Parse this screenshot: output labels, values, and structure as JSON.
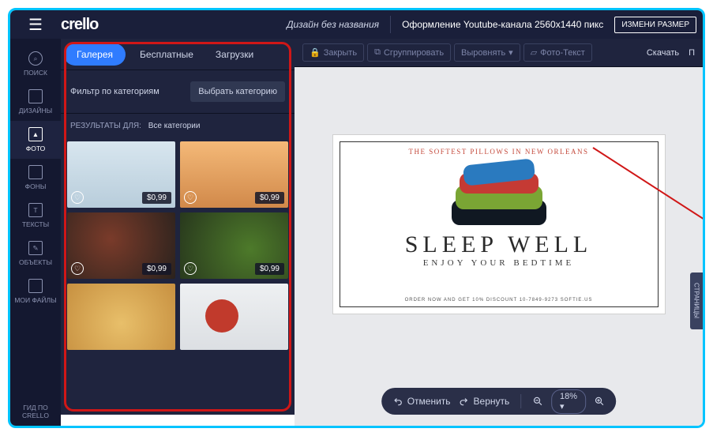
{
  "header": {
    "logo": "crello",
    "project_title": "Дизайн без названия",
    "format": "Оформление Youtube-канала 2560x1440 пикс",
    "resize_btn": "ИЗМЕНИ РАЗМЕР"
  },
  "toolbar": {
    "close": "Закрыть",
    "group": "Сгруппировать",
    "align": "Выровнять",
    "phototext": "Фото-Текст",
    "download": "Скачать"
  },
  "leftnav": {
    "items": [
      {
        "label": "ПОИСК"
      },
      {
        "label": "ДИЗАЙНЫ"
      },
      {
        "label": "ФОТО"
      },
      {
        "label": "ФОНЫ"
      },
      {
        "label": "ТЕКСТЫ"
      },
      {
        "label": "ОБЪЕКТЫ"
      },
      {
        "label": "МОИ ФАЙЛЫ"
      }
    ],
    "guide": "ГИД ПО CRELLO"
  },
  "panel": {
    "tabs": [
      "Галерея",
      "Бесплатные",
      "Загрузки"
    ],
    "filter_label": "Фильтр по категориям",
    "filter_btn": "Выбрать категорию",
    "results_label": "РЕЗУЛЬТАТЫ ДЛЯ:",
    "results_value": "Все категории",
    "price": "$0,99"
  },
  "artboard": {
    "tagline": "THE SOFTEST PILLOWS IN NEW ORLEANS",
    "h1": "SLEEP WELL",
    "h2": "ENJOY YOUR BEDTIME",
    "footer": "ORDER NOW AND GET 10% DISCOUNT   10-7849-9273   SOFTIE.US"
  },
  "zoombar": {
    "undo": "Отменить",
    "redo": "Вернуть",
    "zoom": "18%"
  },
  "side_tab": "СТРАНИЦЫ"
}
